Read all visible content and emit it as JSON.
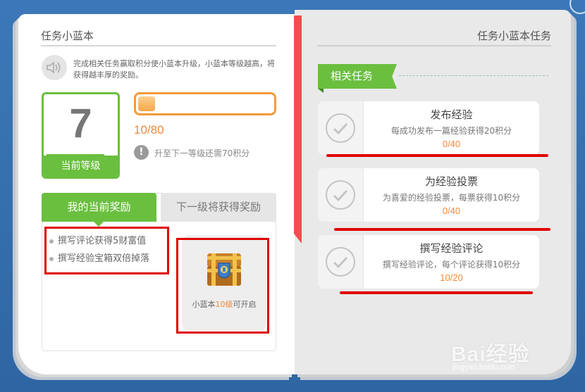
{
  "left_page": {
    "title": "任务小蓝本",
    "intro": "完成相关任务赢取积分使小蓝本升级，小蓝本等级越高，将获得越丰厚的奖励。",
    "level": {
      "value": "7",
      "label": "当前等级"
    },
    "progress": {
      "text": "10/80",
      "fraction": 0.125
    },
    "hint": {
      "icon": "!",
      "text": "升至下一等级还需70积分"
    },
    "tabs": {
      "current": "我的当前奖励",
      "next": "下一级将获得奖励"
    },
    "rewards": [
      "撰写评论获得5财富值",
      "撰写经验宝箱双倍掉落"
    ],
    "chest": {
      "caption_prefix": "小蓝本",
      "caption_level": "10级",
      "caption_suffix": "可开启"
    }
  },
  "right_page": {
    "title": "任务小蓝本任务",
    "section_label": "相关任务",
    "tasks": [
      {
        "name": "发布经验",
        "desc": "每成功发布一篇经验获得20积分",
        "progress": "0/40"
      },
      {
        "name": "为经验投票",
        "desc": "为喜爱的经验投票，每票获得10积分",
        "progress": "0/40"
      },
      {
        "name": "撰写经验评论",
        "desc": "撰写经验评论，每个评论获得10积分",
        "progress": "10/20"
      }
    ]
  },
  "watermark": {
    "brand": "Bai经验",
    "url": "jingyan.baidu.com"
  },
  "colors": {
    "green": "#6abf3f",
    "orange": "#f0883a",
    "red_annotation": "#e00000",
    "bookmark": "#ef4e4e",
    "frame_blue": "#2f6aa8"
  }
}
